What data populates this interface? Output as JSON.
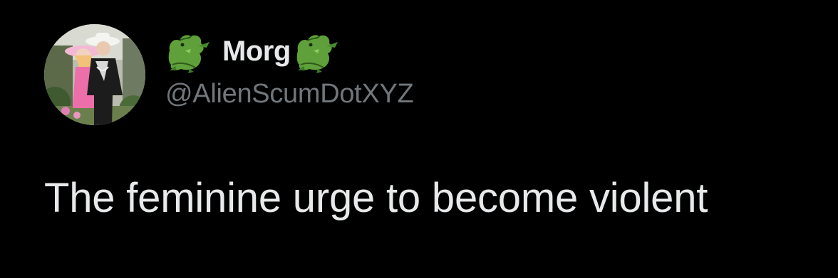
{
  "tweet": {
    "author": {
      "display_name": "Morg",
      "name_emoji": "alligator-emoji",
      "handle": "@AlienScumDotXYZ",
      "avatar": "profile-photo"
    },
    "text": "The feminine urge to become violent"
  },
  "colors": {
    "background": "#000000",
    "primary_text": "#e7e9ea",
    "secondary_text": "#71767b",
    "emoji_green": "#5fa03a"
  }
}
